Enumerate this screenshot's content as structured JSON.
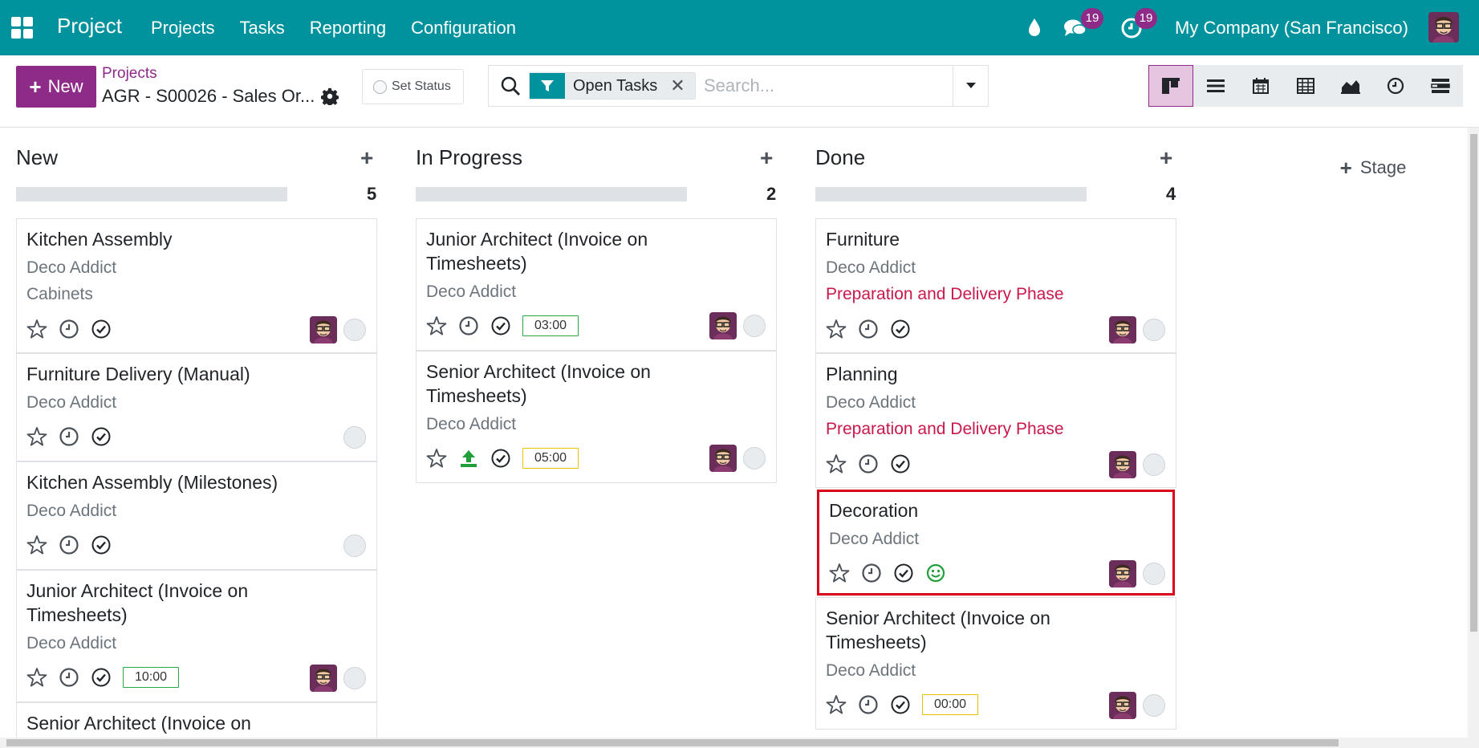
{
  "navbar": {
    "app_name": "Project",
    "menu": [
      "Projects",
      "Tasks",
      "Reporting",
      "Configuration"
    ],
    "chat_count": "19",
    "activity_count": "19",
    "company": "My Company (San Francisco)",
    "bg_color": "#00939d"
  },
  "control": {
    "new_label": "New",
    "breadcrumb_parent": "Projects",
    "breadcrumb_current": "AGR - S00026 - Sales Or...",
    "set_status": "Set Status",
    "filter_facet": "Open Tasks",
    "search_placeholder": "Search...",
    "views": [
      "kanban-icon",
      "list-icon",
      "calendar-icon",
      "pivot-icon",
      "graph-icon",
      "activity-icon",
      "gantt-icon"
    ]
  },
  "columns": [
    {
      "title": "New",
      "count": "5",
      "cards": [
        {
          "title": "Kitchen Assembly",
          "customer": "Deco Addict",
          "tag": "Cabinets"
        },
        {
          "title": "Furniture Delivery (Manual)",
          "customer": "Deco Addict"
        },
        {
          "title": "Kitchen Assembly (Milestones)",
          "customer": "Deco Addict"
        },
        {
          "title": "Junior Architect (Invoice on Timesheets)",
          "customer": "Deco Addict",
          "time": "10:00"
        },
        {
          "title": "Senior Architect (Invoice on"
        }
      ]
    },
    {
      "title": "In Progress",
      "count": "2",
      "cards": [
        {
          "title": "Junior Architect (Invoice on Timesheets)",
          "customer": "Deco Addict",
          "time": "03:00"
        },
        {
          "title": "Senior Architect (Invoice on Timesheets)",
          "customer": "Deco Addict",
          "time": "05:00"
        }
      ]
    },
    {
      "title": "Done",
      "count": "4",
      "cards": [
        {
          "title": "Furniture",
          "customer": "Deco Addict",
          "tag": "Preparation and Delivery Phase"
        },
        {
          "title": "Planning",
          "customer": "Deco Addict",
          "tag": "Preparation and Delivery Phase"
        },
        {
          "title": "Decoration",
          "customer": "Deco Addict"
        },
        {
          "title": "Senior Architect (Invoice on Timesheets)",
          "customer": "Deco Addict",
          "time": "00:00"
        }
      ]
    }
  ],
  "add_stage_label": "Stage",
  "colors": {
    "accent": "#8e2a88",
    "tag_red": "#c9184a",
    "highlight": "#d9001b"
  }
}
